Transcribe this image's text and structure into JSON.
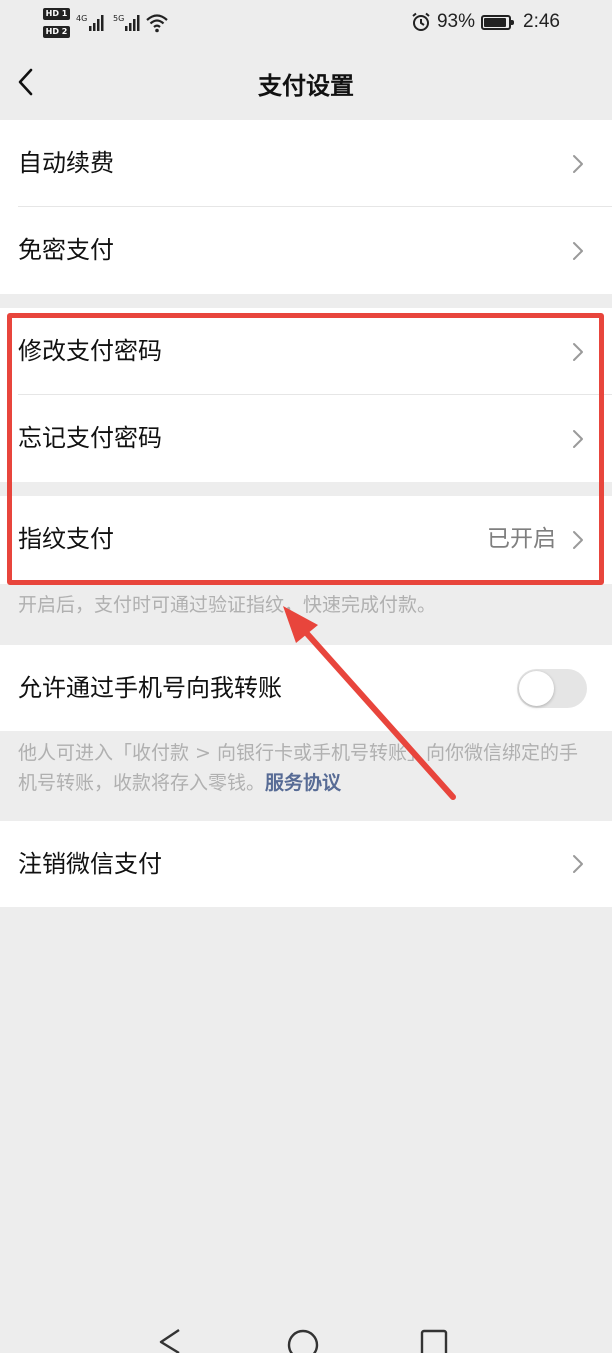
{
  "status_bar": {
    "hd1": "HD 1",
    "hd2": "HD 2",
    "network1": "4G",
    "network2": "5G",
    "battery_percent": "93%",
    "battery_level": 0.93,
    "time": "2:46",
    "icons": [
      "alarm-icon",
      "wifi-icon",
      "battery-icon",
      "signal-icon"
    ]
  },
  "nav": {
    "title": "支付设置",
    "back_icon": "chevron-left-icon"
  },
  "group1": [
    {
      "label": "自动续费"
    },
    {
      "label": "免密支付"
    }
  ],
  "group2": [
    {
      "label": "修改支付密码"
    },
    {
      "label": "忘记支付密码"
    }
  ],
  "group3": {
    "label": "指纹支付",
    "value": "已开启"
  },
  "fingerprint_hint": "开启后，支付时可通过验证指纹，快速完成付款。",
  "phone_transfer": {
    "label": "允许通过手机号向我转账",
    "enabled": false
  },
  "transfer_hint": {
    "text": "他人可进入「收付款 > 向银行卡或手机号转账」向你微信绑定的手机号转账，收款将存入零钱。",
    "link": "服务协议"
  },
  "group5": [
    {
      "label": "注销微信支付"
    }
  ],
  "colors": {
    "background": "#ededed",
    "annotation": "#e8453c",
    "link": "#576b95",
    "hint_text": "#b0b0b0"
  }
}
